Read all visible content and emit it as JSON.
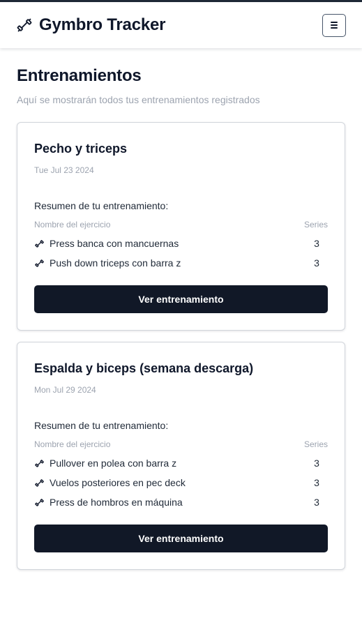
{
  "header": {
    "brand_icon": "dumbbell-icon",
    "title": "Gymbro Tracker",
    "menu_icon": "hamburger-menu-icon"
  },
  "page": {
    "title": "Entrenamientos",
    "subtitle": "Aquí se mostrarán todos tus entrenamientos registrados"
  },
  "colors": {
    "primary_button": "#111827",
    "muted_text": "#9ca3af",
    "heading_text": "#0f172a",
    "card_border": "#d1d5db"
  },
  "workouts": [
    {
      "title": "Pecho y triceps",
      "date": "Tue Jul 23 2024",
      "summary_label": "Resumen de tu entrenamiento:",
      "col_exercise": "Nombre del ejercicio",
      "col_series": "Series",
      "exercises": [
        {
          "icon": "dumbbell-small-icon",
          "name": "Press banca con mancuernas",
          "series": "3"
        },
        {
          "icon": "dumbbell-small-icon",
          "name": "Push down triceps con barra z",
          "series": "3"
        }
      ],
      "button_label": "Ver entrenamiento"
    },
    {
      "title": "Espalda y biceps (semana descarga)",
      "date": "Mon Jul 29 2024",
      "summary_label": "Resumen de tu entrenamiento:",
      "col_exercise": "Nombre del ejercicio",
      "col_series": "Series",
      "exercises": [
        {
          "icon": "dumbbell-small-icon",
          "name": "Pullover en polea con barra z",
          "series": "3"
        },
        {
          "icon": "dumbbell-small-icon",
          "name": "Vuelos posteriores en pec deck",
          "series": "3"
        },
        {
          "icon": "dumbbell-small-icon",
          "name": "Press de hombros en máquina",
          "series": "3"
        }
      ],
      "button_label": "Ver entrenamiento"
    }
  ]
}
